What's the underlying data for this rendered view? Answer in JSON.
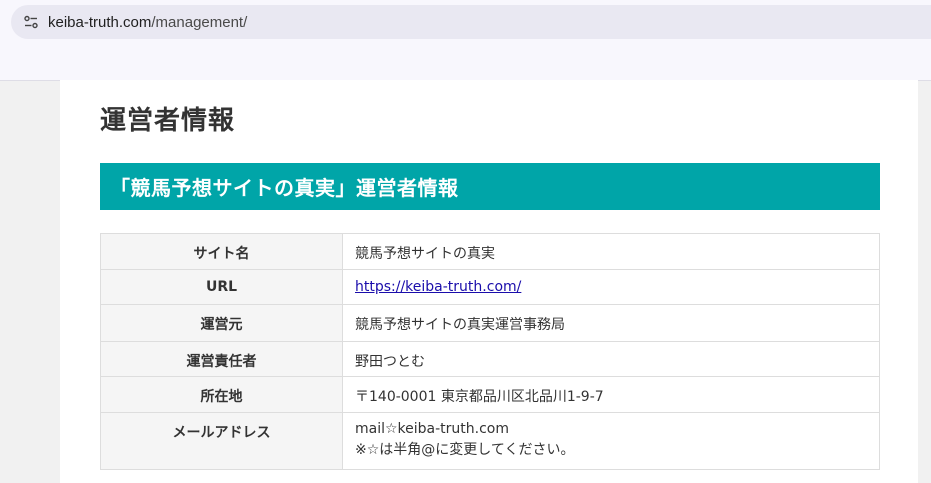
{
  "browser": {
    "url_host": "keiba-truth.com",
    "url_path": "/management/"
  },
  "page": {
    "title": "運営者情報",
    "section_heading": "「競馬予想サイトの真実」運営者情報",
    "rows": [
      {
        "label": "サイト名",
        "value": "競馬予想サイトの真実"
      },
      {
        "label": "URL",
        "value": "https://keiba-truth.com/"
      },
      {
        "label": "運営元",
        "value": "競馬予想サイトの真実運営事務局"
      },
      {
        "label": "運営責任者",
        "value": "野田つとむ"
      },
      {
        "label": "所在地",
        "value": "〒140-0001 東京都品川区北品川1-9-7"
      },
      {
        "label": "メールアドレス",
        "value_line1": "mail☆keiba-truth.com",
        "value_line2": "※☆は半角@に変更してください。"
      }
    ]
  },
  "colors": {
    "accent": "#00a5a8",
    "link": "#1a0dab"
  }
}
